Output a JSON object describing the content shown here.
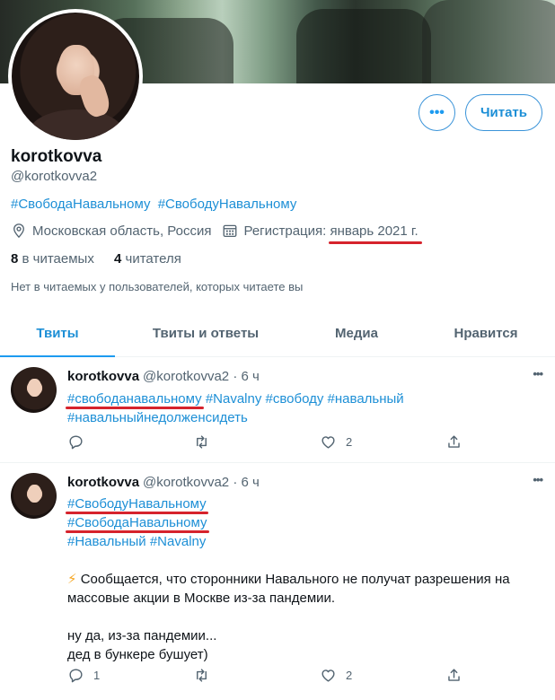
{
  "profile": {
    "display_name": "korotkovva",
    "handle": "@korotkovva2",
    "bio_tags": [
      "#СвободаНавальному",
      "#СвободуНавальному"
    ],
    "location": "Московская область, Россия",
    "joined_label": "Регистрация:",
    "joined_date": "январь 2021 г.",
    "following_count": "8",
    "following_label": "в читаемых",
    "followers_count": "4",
    "followers_label": "читателя",
    "no_mutuals_text": "Нет в читаемых у пользователей, которых читаете вы"
  },
  "actions": {
    "more_label": "•••",
    "follow_label": "Читать"
  },
  "tabs": [
    {
      "label": "Твиты"
    },
    {
      "label": "Твиты и ответы"
    },
    {
      "label": "Медиа"
    },
    {
      "label": "Нравится"
    }
  ],
  "tweets": [
    {
      "name": "korotkovva",
      "handle": "@korotkovva2",
      "time": "· 6 ч",
      "more": "•••",
      "tags_line1": [
        "#свободанавальному",
        "#Navalny",
        "#свободу",
        "#навальный"
      ],
      "tags_line2": [
        "#навальныйнедолженсидеть"
      ],
      "replies": "",
      "likes": "2"
    },
    {
      "name": "korotkovva",
      "handle": "@korotkovva2",
      "time": "· 6 ч",
      "more": "•••",
      "tags": [
        "#СвободуНавальному",
        "#СвободаНавальному",
        "#Навальный",
        "#Navalny"
      ],
      "bolt": "⚡",
      "text1": "Сообщается, что сторонники Навального не получат разрешения на массовые акции в Москве из-за пандемии.",
      "text2": "ну да, из-за пандемии...",
      "text3": "дед в бункере бушует)",
      "replies": "1",
      "likes": "2"
    }
  ],
  "icons": {
    "location": "location-pin-icon",
    "calendar": "calendar-icon",
    "reply": "reply-icon",
    "retweet": "retweet-icon",
    "like": "like-icon",
    "share": "share-icon"
  },
  "colors": {
    "accent": "#1d9bf0",
    "underline": "#d6232c"
  }
}
